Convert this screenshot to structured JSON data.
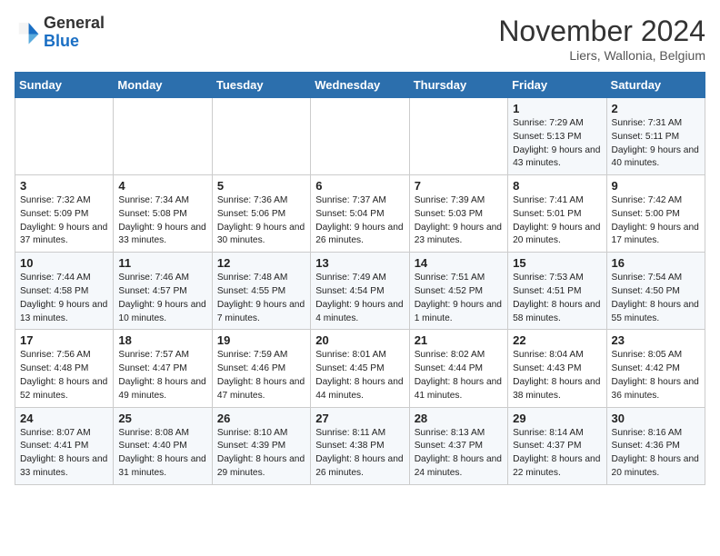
{
  "header": {
    "logo_general": "General",
    "logo_blue": "Blue",
    "month_title": "November 2024",
    "location": "Liers, Wallonia, Belgium"
  },
  "days_of_week": [
    "Sunday",
    "Monday",
    "Tuesday",
    "Wednesday",
    "Thursday",
    "Friday",
    "Saturday"
  ],
  "weeks": [
    [
      {
        "day": "",
        "content": ""
      },
      {
        "day": "",
        "content": ""
      },
      {
        "day": "",
        "content": ""
      },
      {
        "day": "",
        "content": ""
      },
      {
        "day": "",
        "content": ""
      },
      {
        "day": "1",
        "content": "Sunrise: 7:29 AM\nSunset: 5:13 PM\nDaylight: 9 hours and 43 minutes."
      },
      {
        "day": "2",
        "content": "Sunrise: 7:31 AM\nSunset: 5:11 PM\nDaylight: 9 hours and 40 minutes."
      }
    ],
    [
      {
        "day": "3",
        "content": "Sunrise: 7:32 AM\nSunset: 5:09 PM\nDaylight: 9 hours and 37 minutes."
      },
      {
        "day": "4",
        "content": "Sunrise: 7:34 AM\nSunset: 5:08 PM\nDaylight: 9 hours and 33 minutes."
      },
      {
        "day": "5",
        "content": "Sunrise: 7:36 AM\nSunset: 5:06 PM\nDaylight: 9 hours and 30 minutes."
      },
      {
        "day": "6",
        "content": "Sunrise: 7:37 AM\nSunset: 5:04 PM\nDaylight: 9 hours and 26 minutes."
      },
      {
        "day": "7",
        "content": "Sunrise: 7:39 AM\nSunset: 5:03 PM\nDaylight: 9 hours and 23 minutes."
      },
      {
        "day": "8",
        "content": "Sunrise: 7:41 AM\nSunset: 5:01 PM\nDaylight: 9 hours and 20 minutes."
      },
      {
        "day": "9",
        "content": "Sunrise: 7:42 AM\nSunset: 5:00 PM\nDaylight: 9 hours and 17 minutes."
      }
    ],
    [
      {
        "day": "10",
        "content": "Sunrise: 7:44 AM\nSunset: 4:58 PM\nDaylight: 9 hours and 13 minutes."
      },
      {
        "day": "11",
        "content": "Sunrise: 7:46 AM\nSunset: 4:57 PM\nDaylight: 9 hours and 10 minutes."
      },
      {
        "day": "12",
        "content": "Sunrise: 7:48 AM\nSunset: 4:55 PM\nDaylight: 9 hours and 7 minutes."
      },
      {
        "day": "13",
        "content": "Sunrise: 7:49 AM\nSunset: 4:54 PM\nDaylight: 9 hours and 4 minutes."
      },
      {
        "day": "14",
        "content": "Sunrise: 7:51 AM\nSunset: 4:52 PM\nDaylight: 9 hours and 1 minute."
      },
      {
        "day": "15",
        "content": "Sunrise: 7:53 AM\nSunset: 4:51 PM\nDaylight: 8 hours and 58 minutes."
      },
      {
        "day": "16",
        "content": "Sunrise: 7:54 AM\nSunset: 4:50 PM\nDaylight: 8 hours and 55 minutes."
      }
    ],
    [
      {
        "day": "17",
        "content": "Sunrise: 7:56 AM\nSunset: 4:48 PM\nDaylight: 8 hours and 52 minutes."
      },
      {
        "day": "18",
        "content": "Sunrise: 7:57 AM\nSunset: 4:47 PM\nDaylight: 8 hours and 49 minutes."
      },
      {
        "day": "19",
        "content": "Sunrise: 7:59 AM\nSunset: 4:46 PM\nDaylight: 8 hours and 47 minutes."
      },
      {
        "day": "20",
        "content": "Sunrise: 8:01 AM\nSunset: 4:45 PM\nDaylight: 8 hours and 44 minutes."
      },
      {
        "day": "21",
        "content": "Sunrise: 8:02 AM\nSunset: 4:44 PM\nDaylight: 8 hours and 41 minutes."
      },
      {
        "day": "22",
        "content": "Sunrise: 8:04 AM\nSunset: 4:43 PM\nDaylight: 8 hours and 38 minutes."
      },
      {
        "day": "23",
        "content": "Sunrise: 8:05 AM\nSunset: 4:42 PM\nDaylight: 8 hours and 36 minutes."
      }
    ],
    [
      {
        "day": "24",
        "content": "Sunrise: 8:07 AM\nSunset: 4:41 PM\nDaylight: 8 hours and 33 minutes."
      },
      {
        "day": "25",
        "content": "Sunrise: 8:08 AM\nSunset: 4:40 PM\nDaylight: 8 hours and 31 minutes."
      },
      {
        "day": "26",
        "content": "Sunrise: 8:10 AM\nSunset: 4:39 PM\nDaylight: 8 hours and 29 minutes."
      },
      {
        "day": "27",
        "content": "Sunrise: 8:11 AM\nSunset: 4:38 PM\nDaylight: 8 hours and 26 minutes."
      },
      {
        "day": "28",
        "content": "Sunrise: 8:13 AM\nSunset: 4:37 PM\nDaylight: 8 hours and 24 minutes."
      },
      {
        "day": "29",
        "content": "Sunrise: 8:14 AM\nSunset: 4:37 PM\nDaylight: 8 hours and 22 minutes."
      },
      {
        "day": "30",
        "content": "Sunrise: 8:16 AM\nSunset: 4:36 PM\nDaylight: 8 hours and 20 minutes."
      }
    ]
  ]
}
